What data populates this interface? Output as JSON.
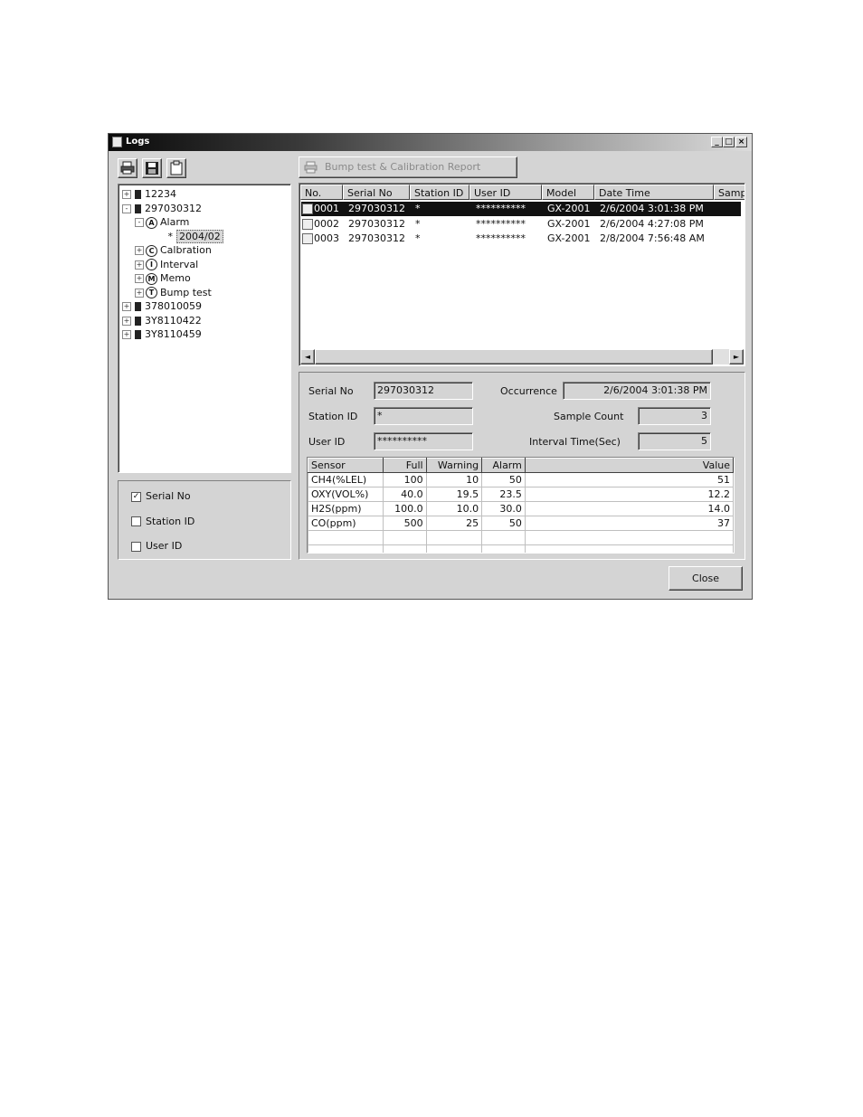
{
  "window": {
    "title": "Logs",
    "controls": [
      "_",
      "□",
      "×"
    ]
  },
  "toolbar": {
    "icons": [
      "print-icon",
      "save-icon",
      "clipboard-icon"
    ]
  },
  "report_button": {
    "label": "Bump test & Calibration Report"
  },
  "tree": [
    {
      "label": "12234",
      "expander": "+",
      "level": 0,
      "kind": "device"
    },
    {
      "label": "297030312",
      "expander": "-",
      "level": 0,
      "kind": "device"
    },
    {
      "label": "Alarm",
      "expander": "-",
      "level": 1,
      "kind": "category",
      "glyph": "A"
    },
    {
      "label": "2004/02",
      "expander": "",
      "level": 2,
      "kind": "leaf",
      "selected": true
    },
    {
      "label": "Calbration",
      "expander": "+",
      "level": 1,
      "kind": "category",
      "glyph": "C"
    },
    {
      "label": "Interval",
      "expander": "+",
      "level": 1,
      "kind": "category",
      "glyph": "I"
    },
    {
      "label": "Memo",
      "expander": "+",
      "level": 1,
      "kind": "category",
      "glyph": "M"
    },
    {
      "label": "Bump test",
      "expander": "+",
      "level": 1,
      "kind": "category",
      "glyph": "T"
    },
    {
      "label": "378010059",
      "expander": "+",
      "level": 0,
      "kind": "device"
    },
    {
      "label": "3Y8110422",
      "expander": "+",
      "level": 0,
      "kind": "device"
    },
    {
      "label": "3Y8110459",
      "expander": "+",
      "level": 0,
      "kind": "device"
    }
  ],
  "filters": [
    {
      "label": "Serial No",
      "checked": true
    },
    {
      "label": "Station ID",
      "checked": false
    },
    {
      "label": "User ID",
      "checked": false
    }
  ],
  "log_list": {
    "columns": [
      "No.",
      "Serial No",
      "Station ID",
      "User ID",
      "Model",
      "Date Time",
      "Samp"
    ],
    "rows": [
      {
        "no": "0001",
        "serial": "297030312",
        "station": "*",
        "user": "**********",
        "model": "GX-2001",
        "datetime": "2/6/2004 3:01:38 PM",
        "selected": true
      },
      {
        "no": "0002",
        "serial": "297030312",
        "station": "*",
        "user": "**********",
        "model": "GX-2001",
        "datetime": "2/6/2004 4:27:08 PM",
        "selected": false
      },
      {
        "no": "0003",
        "serial": "297030312",
        "station": "*",
        "user": "**********",
        "model": "GX-2001",
        "datetime": "2/8/2004 7:56:48 AM",
        "selected": false
      }
    ]
  },
  "detail": {
    "serial_label": "Serial No",
    "serial_value": "297030312",
    "station_label": "Station ID",
    "station_value": "*",
    "user_label": "User ID",
    "user_value": "**********",
    "occurrence_label": "Occurrence",
    "occurrence_value": "2/6/2004 3:01:38 PM",
    "sample_count_label": "Sample Count",
    "sample_count_value": "3",
    "interval_label": "Interval Time(Sec)",
    "interval_value": "5"
  },
  "sensor_table": {
    "columns": [
      "Sensor",
      "Full",
      "Warning",
      "Alarm",
      "Value"
    ],
    "rows": [
      [
        "CH4(%LEL)",
        "100",
        "10",
        "50",
        "51"
      ],
      [
        "OXY(VOL%)",
        "40.0",
        "19.5",
        "23.5",
        "12.2"
      ],
      [
        "H2S(ppm)",
        "100.0",
        "10.0",
        "30.0",
        "14.0"
      ],
      [
        "CO(ppm)",
        "500",
        "25",
        "50",
        "37"
      ]
    ]
  },
  "close_button": {
    "label": "Close"
  }
}
